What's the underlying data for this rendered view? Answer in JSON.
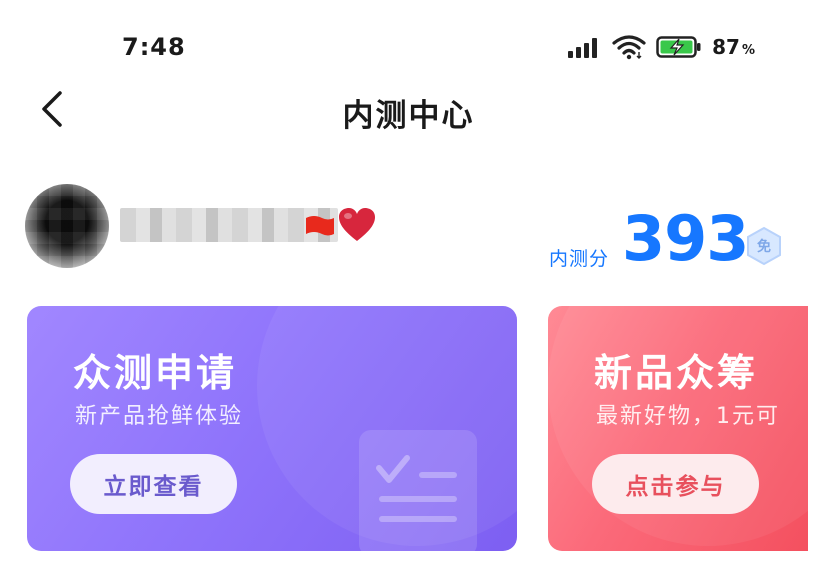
{
  "status_bar": {
    "time": "7:48",
    "battery_percent": "87",
    "battery_unit": "%",
    "icons": [
      "signal-icon",
      "wifi-icon",
      "battery-charging-icon"
    ]
  },
  "header": {
    "title": "内测中心",
    "back_icon": "chevron-left-icon"
  },
  "profile": {
    "score_label": "内测分",
    "score_value": "393",
    "badge_text": "免"
  },
  "cards": [
    {
      "title": "众测申请",
      "subtitle": "新产品抢鲜体验",
      "button": "立即查看",
      "icon": "checklist-document-icon",
      "color_start": "#a187ff",
      "color_end": "#7d5ff2"
    },
    {
      "title": "新品众筹",
      "subtitle": "最新好物，1元可",
      "button": "点击参与",
      "color_start": "#ff8a95",
      "color_end": "#f4505f"
    }
  ],
  "colors": {
    "accent": "#1677ff",
    "purple_button_text": "#6a5acd",
    "red_button_text": "#e8505d"
  }
}
